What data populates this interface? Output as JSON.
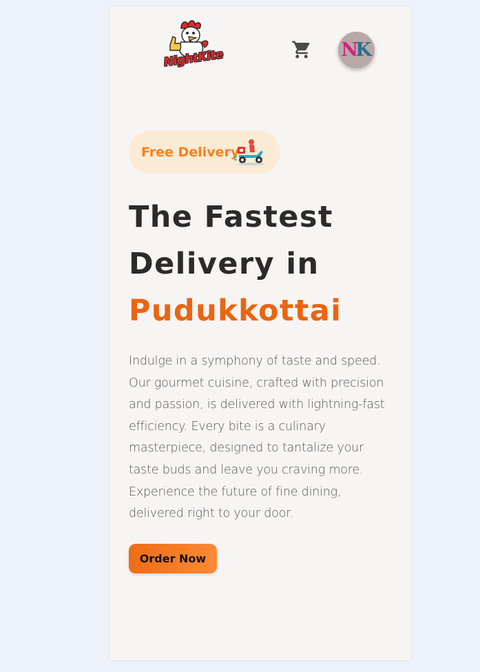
{
  "header": {
    "logo_text": "NightKite",
    "logo_icon": "rooster-mascot-icon",
    "cart_icon": "shopping-cart-icon",
    "avatar": {
      "initial_1": "N",
      "initial_2": "K"
    }
  },
  "hero": {
    "badge": {
      "label": "Free Delivery",
      "icon": "delivery-scooter-icon"
    },
    "headline_line1": "The Fastest",
    "headline_line2": "Delivery in",
    "headline_accent": "Pudukkottai",
    "description": "Indulge in a symphony of taste and speed. Our gourmet cuisine, crafted with precision and passion, is delivered with lightning-fast efficiency. Every bite is a culinary masterpiece, designed to tantalize your taste buds and leave you craving more. Experience the future of fine dining, delivered right to your door.",
    "cta_label": "Order Now"
  },
  "colors": {
    "page_background": "#edf1f9",
    "card_background": "#f7f4f4",
    "accent": "#ea6510",
    "badge_background": "#fcebd4",
    "badge_text": "#f58220",
    "heading": "#2b2b2b",
    "body_text": "#555555"
  }
}
